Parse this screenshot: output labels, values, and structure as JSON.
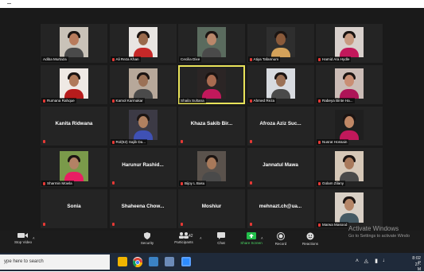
{
  "participants": [
    {
      "name": "Adiba Murtaza",
      "muted": false,
      "kind": "photo",
      "bg": "#c9c2b8",
      "skin": "#b87b5c"
    },
    {
      "name": "Ali Reza Khan",
      "muted": true,
      "kind": "photo",
      "bg": "#e8e5e2",
      "skin": "#9a6a4c",
      "accent": "#c62828"
    },
    {
      "name": "Cecilia Dixe",
      "muted": false,
      "kind": "photo",
      "bg": "#5a6b5e",
      "skin": "#b9876a"
    },
    {
      "name": "Atiya Tafannum",
      "muted": true,
      "kind": "photo",
      "bg": "#2e2e2e",
      "skin": "#8a5a3a",
      "accent": "#d4a25a"
    },
    {
      "name": "Hamid Ara Hydle",
      "muted": true,
      "kind": "photo",
      "bg": "#d8d0cc",
      "skin": "#c89a80",
      "accent": "#c2185b"
    },
    {
      "name": "Rumana Rahque",
      "muted": true,
      "kind": "photo",
      "bg": "#efe9e4",
      "skin": "#b07a5a",
      "accent": "#b71c1c"
    },
    {
      "name": "Kamol Karmakar",
      "muted": true,
      "kind": "photo",
      "bg": "#b7a89a",
      "skin": "#9b7156"
    },
    {
      "name": "Shaila Sultana",
      "muted": false,
      "kind": "photo",
      "bg": "#2b2525",
      "skin": "#a86b50",
      "active": true,
      "accent": "#c2185b"
    },
    {
      "name": "Ahmed Reza",
      "muted": true,
      "kind": "photo",
      "bg": "#d8dbe0",
      "skin": "#9b7156"
    },
    {
      "name": "Rabeya Binte Ha...",
      "muted": true,
      "kind": "photo",
      "bg": "#cbbcb6",
      "skin": "#c98e74",
      "accent": "#ad1457"
    },
    {
      "name": "Kanita Ridwana",
      "muted": false,
      "kind": "name"
    },
    {
      "name": "Rol(62) Sajib Da...",
      "muted": true,
      "kind": "photo",
      "bg": "#3c3a45",
      "skin": "#b08060",
      "accent": "#3f51b5"
    },
    {
      "name": "Khaza Sakib Bir...",
      "muted": false,
      "kind": "name"
    },
    {
      "name": "Afroza Aziz Suc...",
      "muted": false,
      "kind": "name"
    },
    {
      "name": "Nusrat Hossain",
      "muted": true,
      "kind": "photo",
      "bg": "#1f1f1f",
      "skin": "#c08866",
      "accent": "#c2185b"
    },
    {
      "name": "Sharmin Mowla",
      "muted": true,
      "kind": "photo",
      "bg": "#7a9a4a",
      "skin": "#b38265",
      "accent": "#e91e63"
    },
    {
      "name": "Harunur Rashid...",
      "muted": false,
      "kind": "name"
    },
    {
      "name": "Bijoy L Basu",
      "muted": true,
      "kind": "photo",
      "bg": "#5a524c",
      "skin": "#a8795a"
    },
    {
      "name": "Jannatul Mawa",
      "muted": false,
      "kind": "name"
    },
    {
      "name": "Golam Zilany",
      "muted": true,
      "kind": "photo",
      "bg": "#d6c8b8",
      "skin": "#a97a5c"
    },
    {
      "name": "Sonia",
      "muted": false,
      "kind": "name"
    },
    {
      "name": "Shaheena Chow...",
      "muted": false,
      "kind": "name"
    },
    {
      "name": "Moshiur",
      "muted": false,
      "kind": "name"
    },
    {
      "name": "mehnazt.ch@ua...",
      "muted": false,
      "kind": "name"
    },
    {
      "name": "Marwa Masood",
      "muted": true,
      "kind": "photo",
      "bg": "#d9d0c6",
      "skin": "#b58668",
      "accent": "#455a64"
    }
  ],
  "toolbar": {
    "stop_video": "Stop Video",
    "security": "Security",
    "participants": "Participants",
    "participants_count": "42",
    "chat": "Chat",
    "share_screen": "Share Screen",
    "record": "Record",
    "reactions": "Reactions"
  },
  "watermark": {
    "line1": "Activate Windows",
    "line2": "Go to Settings to activate Windo"
  },
  "taskbar": {
    "search_placeholder": "ype here to search",
    "time": "8:02 P",
    "date": "27-M"
  },
  "colors": {
    "share_green": "#23c04b",
    "active_outline": "#e9e35a",
    "mic_muted": "#e53935"
  }
}
